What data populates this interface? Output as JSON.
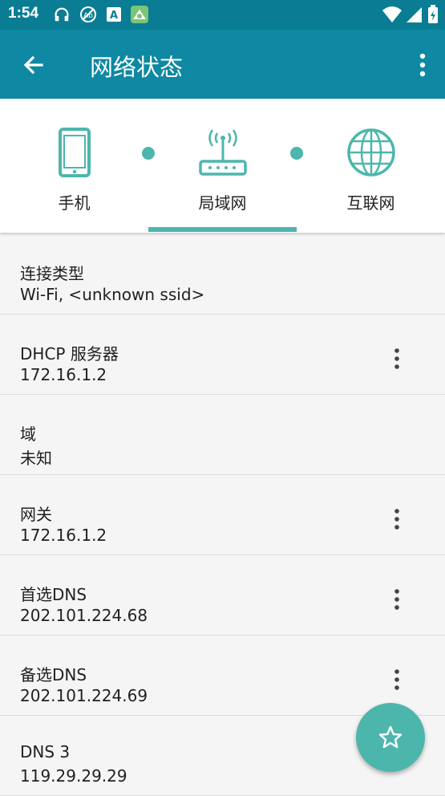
{
  "status_bar": {
    "time": "1:54"
  },
  "app_bar": {
    "title": "网络状态"
  },
  "tabs": [
    {
      "label": "手机",
      "icon": "phone-icon"
    },
    {
      "label": "局域网",
      "icon": "router-icon"
    },
    {
      "label": "互联网",
      "icon": "globe-icon"
    }
  ],
  "rows": [
    {
      "title": "连接类型",
      "value": "Wi-Fi, <unknown ssid>",
      "has_menu": false
    },
    {
      "title": "DHCP 服务器",
      "value": "172.16.1.2",
      "has_menu": true
    },
    {
      "title": "域",
      "value": "未知",
      "has_menu": false
    },
    {
      "title": "网关",
      "value": "172.16.1.2",
      "has_menu": true
    },
    {
      "title": "首选DNS",
      "value": "202.101.224.68",
      "has_menu": true
    },
    {
      "title": "备选DNS",
      "value": "202.101.224.69",
      "has_menu": true
    },
    {
      "title": "DNS 3",
      "value": "119.29.29.29",
      "has_menu": true
    }
  ],
  "colors": {
    "status": "#0a7d94",
    "appbar": "#0e88a3",
    "accent": "#4db6ac"
  },
  "fab": {
    "icon": "star-icon"
  }
}
